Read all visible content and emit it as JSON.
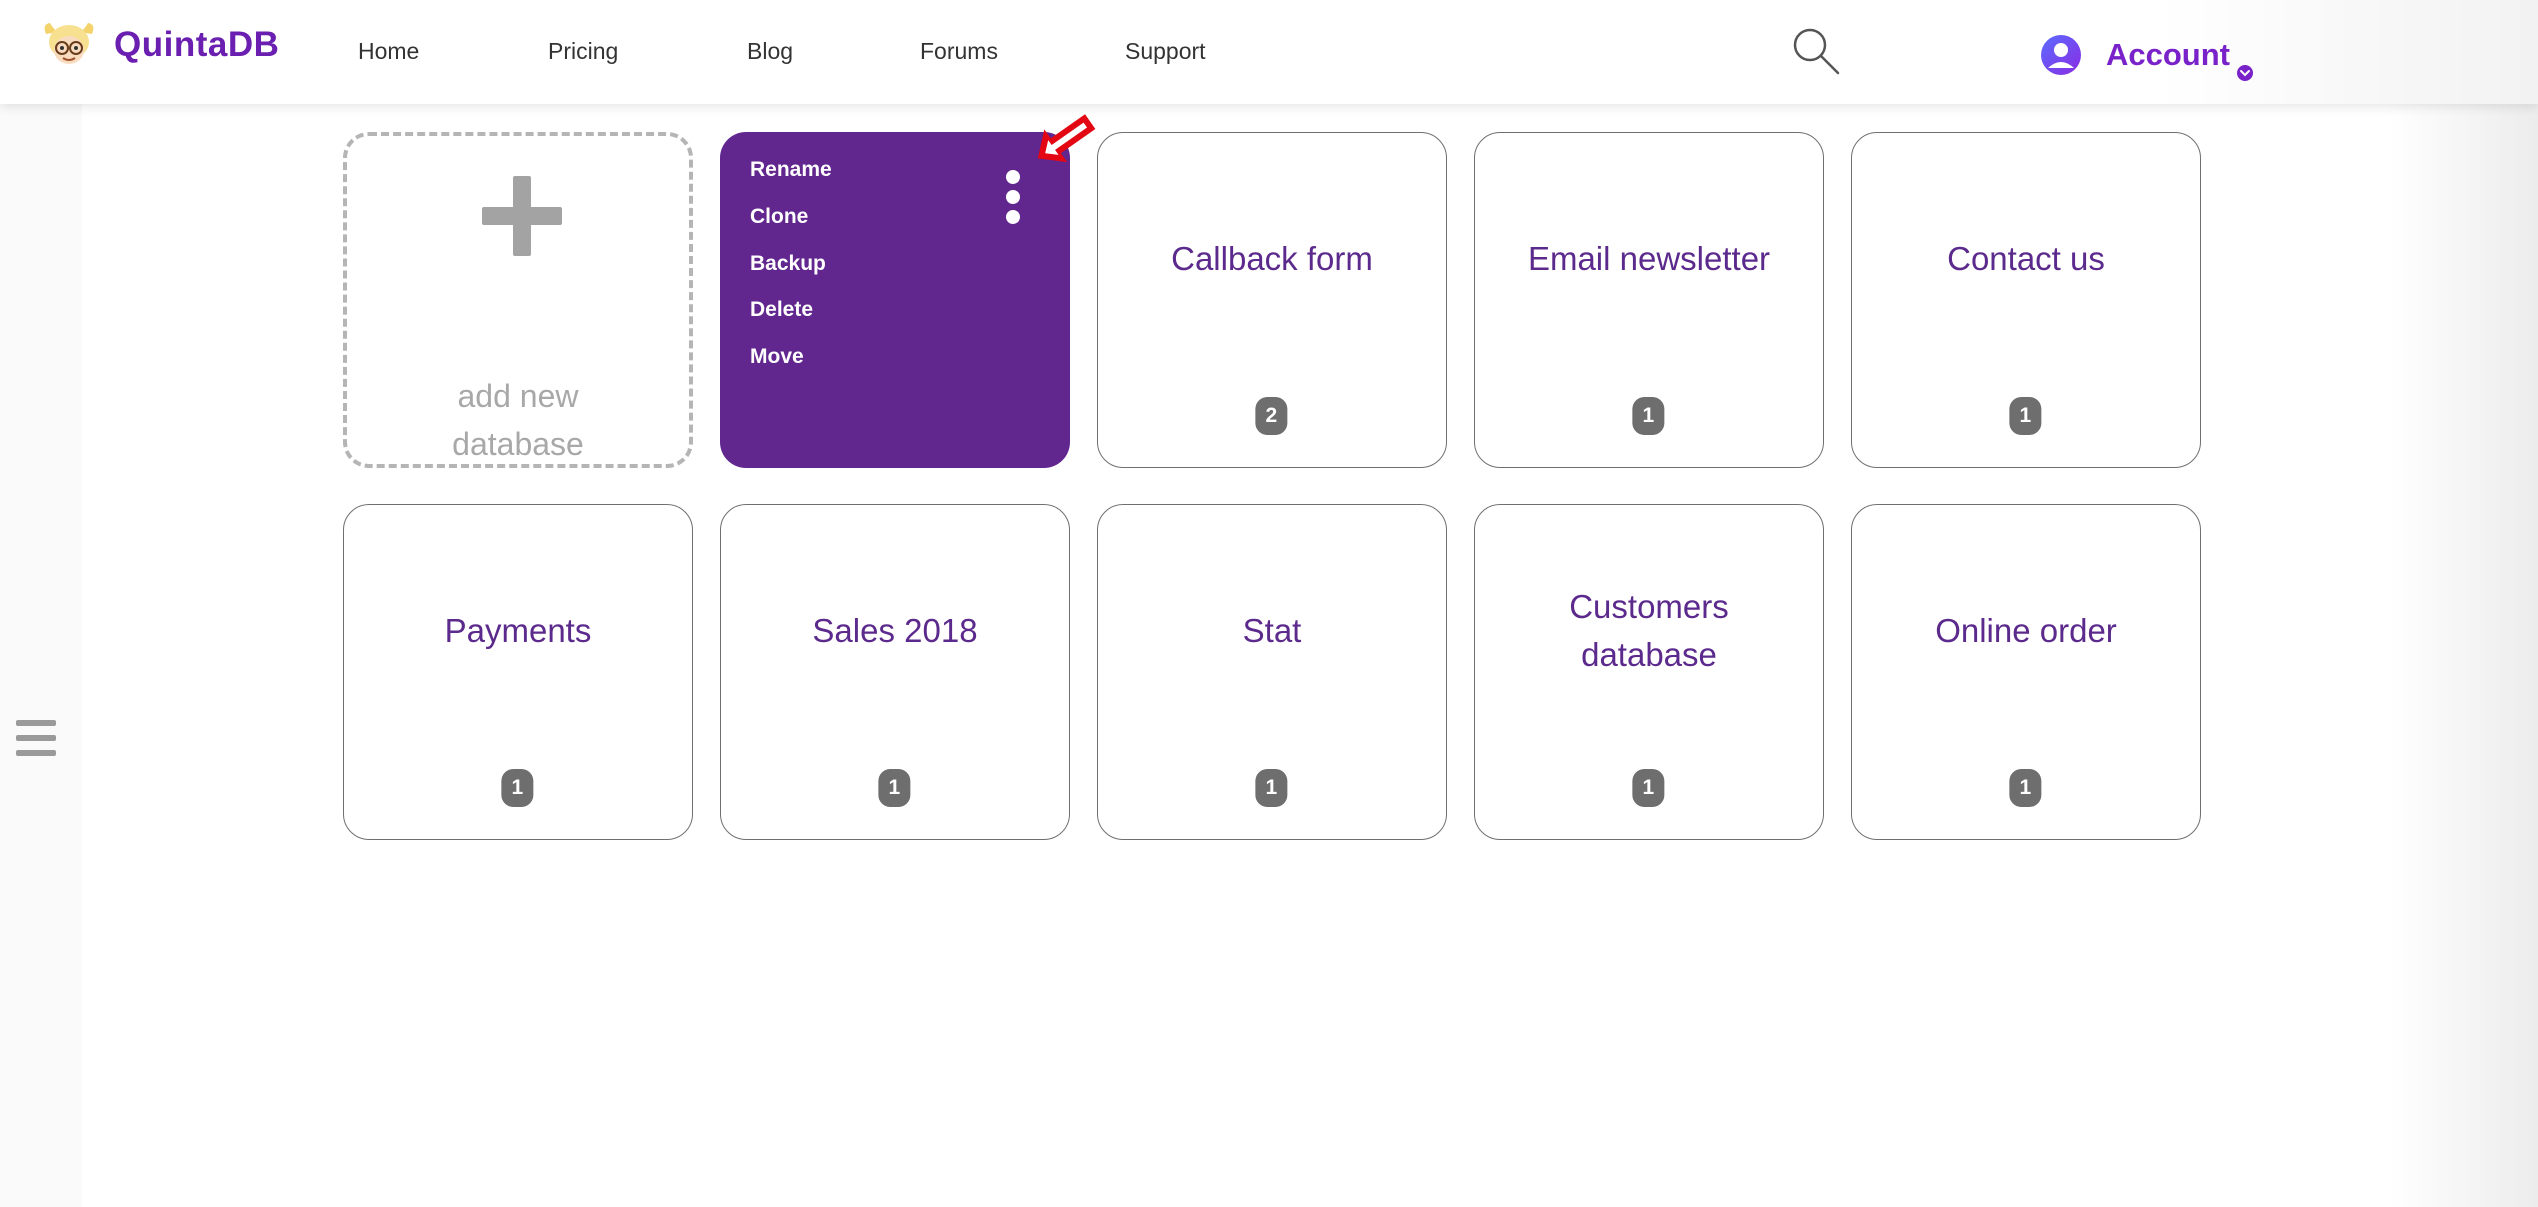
{
  "header": {
    "logo_text": "QuintaDB",
    "nav": [
      "Home",
      "Pricing",
      "Blog",
      "Forums",
      "Support"
    ],
    "account_label": "Account"
  },
  "add_card": {
    "label_line1": "add new",
    "label_line2": "database"
  },
  "active_card": {
    "menu": [
      "Rename",
      "Clone",
      "Backup",
      "Delete",
      "Move"
    ]
  },
  "databases": [
    {
      "title": "Callback form",
      "badge": "2"
    },
    {
      "title": "Email newsletter",
      "badge": "1"
    },
    {
      "title": "Contact us",
      "badge": "1"
    },
    {
      "title": "Payments",
      "badge": "1"
    },
    {
      "title": "Sales 2018",
      "badge": "1"
    },
    {
      "title": "Stat",
      "badge": "1"
    },
    {
      "title_line1": "Customers",
      "title_line2": "database",
      "badge": "1"
    },
    {
      "title": "Online order",
      "badge": "1"
    }
  ],
  "colors": {
    "brand": "#6a1fb0",
    "active_card_bg": "#62268f",
    "card_title": "#5b2a8c",
    "badge_bg": "#6e6e6e",
    "arrow": "#e30613"
  },
  "icons": {
    "search": "search-icon",
    "account": "user-avatar-icon",
    "account_chevron": "chevron-down-icon",
    "kebab": "kebab-menu-icon",
    "hamburger": "hamburger-menu-icon",
    "pointer_arrow": "arrow-pointer-icon"
  }
}
